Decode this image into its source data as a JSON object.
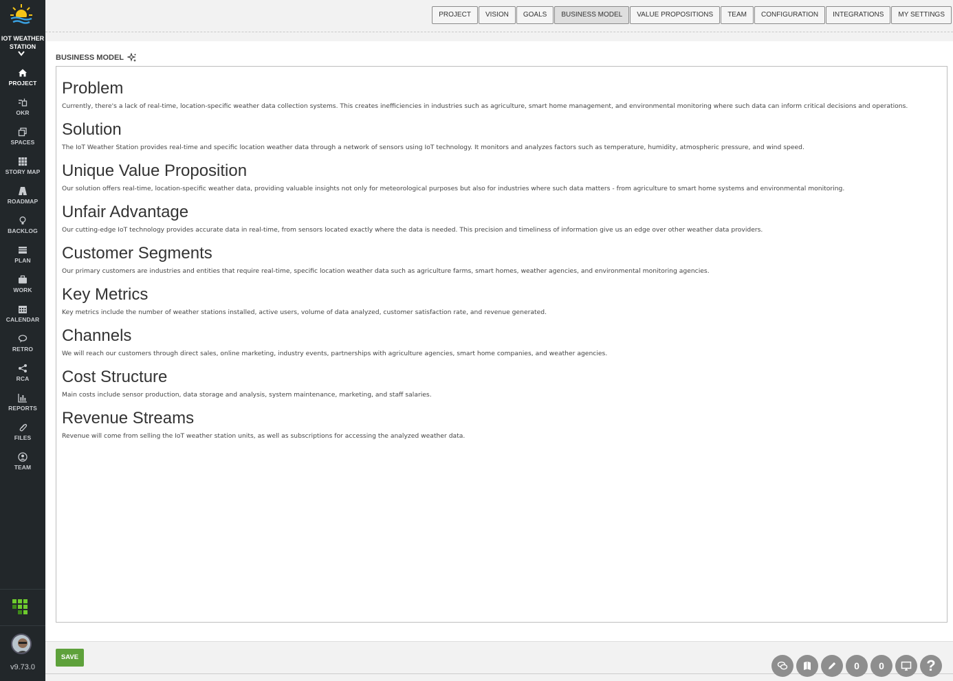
{
  "sidebar": {
    "project_name": "IOT WEATHER STATION",
    "items": [
      {
        "label": "PROJECT",
        "icon": "home-icon"
      },
      {
        "label": "OKR",
        "icon": "okr-icon"
      },
      {
        "label": "SPACES",
        "icon": "spaces-icon"
      },
      {
        "label": "STORY MAP",
        "icon": "story-map-icon"
      },
      {
        "label": "ROADMAP",
        "icon": "roadmap-icon"
      },
      {
        "label": "BACKLOG",
        "icon": "lightbulb-icon"
      },
      {
        "label": "PLAN",
        "icon": "plan-icon"
      },
      {
        "label": "WORK",
        "icon": "briefcase-icon"
      },
      {
        "label": "CALENDAR",
        "icon": "calendar-icon"
      },
      {
        "label": "RETRO",
        "icon": "chat-bubble-icon"
      },
      {
        "label": "RCA",
        "icon": "share-icon"
      },
      {
        "label": "REPORTS",
        "icon": "bar-chart-icon"
      },
      {
        "label": "FILES",
        "icon": "paperclip-icon"
      },
      {
        "label": "TEAM",
        "icon": "team-icon"
      }
    ],
    "version": "v9.73.0"
  },
  "tabs": [
    "PROJECT",
    "VISION",
    "GOALS",
    "BUSINESS MODEL",
    "VALUE PROPOSITIONS",
    "TEAM",
    "CONFIGURATION",
    "INTEGRATIONS",
    "MY SETTINGS"
  ],
  "active_tab": "BUSINESS MODEL",
  "page": {
    "title": "BUSINESS MODEL",
    "sections": [
      {
        "heading": "Problem",
        "text": "Currently, there's a lack of real-time, location-specific weather data collection systems. This creates inefficiencies in industries such as agriculture, smart home management, and environmental monitoring where such data can inform critical decisions and operations."
      },
      {
        "heading": "Solution",
        "text": "The IoT Weather Station provides real-time and specific location weather data through a network of sensors using IoT technology. It monitors and analyzes factors such as temperature, humidity, atmospheric pressure, and wind speed."
      },
      {
        "heading": "Unique Value Proposition",
        "text": "Our solution offers real-time, location-specific weather data, providing valuable insights not only for meteorological purposes but also for industries where such data matters - from agriculture to smart home systems and environmental monitoring."
      },
      {
        "heading": "Unfair Advantage",
        "text": "Our cutting-edge IoT technology provides accurate data in real-time, from sensors located exactly where the data is needed. This precision and timeliness of information give us an edge over other weather data providers."
      },
      {
        "heading": "Customer Segments",
        "text": "Our primary customers are industries and entities that require real-time, specific location weather data such as agriculture farms, smart homes, weather agencies, and environmental monitoring agencies."
      },
      {
        "heading": "Key Metrics",
        "text": "Key metrics include the number of weather stations installed, active users, volume of data analyzed, customer satisfaction rate, and revenue generated."
      },
      {
        "heading": "Channels",
        "text": "We will reach our customers through direct sales, online marketing, industry events, partnerships with agriculture agencies, smart home companies, and weather agencies."
      },
      {
        "heading": "Cost Structure",
        "text": "Main costs include sensor production, data storage and analysis, system maintenance, marketing, and staff salaries."
      },
      {
        "heading": "Revenue Streams",
        "text": "Revenue will come from selling the IoT weather station units, as well as subscriptions for accessing the analyzed weather data."
      }
    ]
  },
  "footer": {
    "save_label": "SAVE",
    "badge_1": "0",
    "badge_2": "0",
    "help": "?"
  },
  "colors": {
    "sidebar_bg": "#22272a",
    "save_green": "#5ea13b",
    "fab_gray": "#8e8e8e"
  }
}
